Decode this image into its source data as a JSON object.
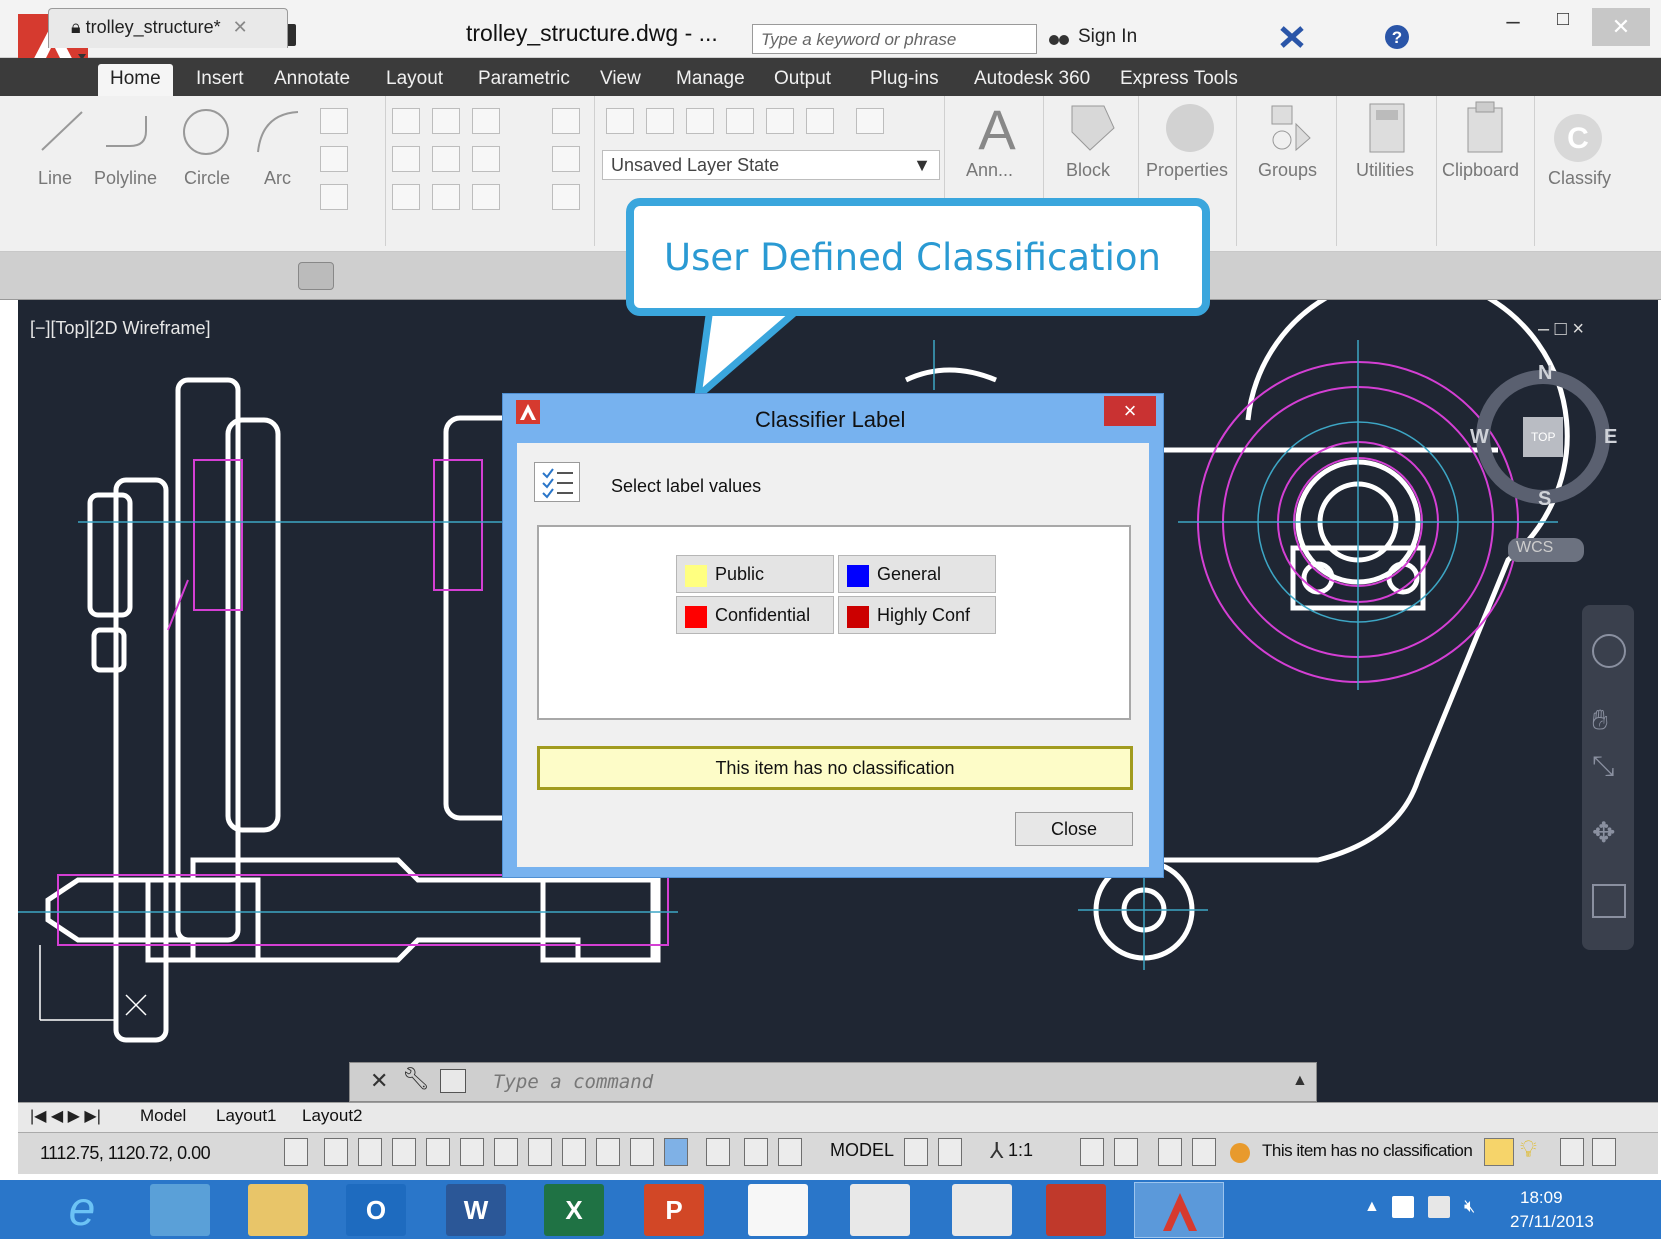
{
  "window": {
    "title": "trolley_structure.dwg - ...",
    "search_placeholder": "Type a keyword or phrase",
    "sign_in": "Sign In"
  },
  "ribbon_tabs": [
    "Home",
    "Insert",
    "Annotate",
    "Layout",
    "Parametric",
    "View",
    "Manage",
    "Output",
    "Plug-ins",
    "Autodesk 360",
    "Express Tools"
  ],
  "ribbon": {
    "draw_tools": [
      "Line",
      "Polyline",
      "Circle",
      "Arc"
    ],
    "layer_state": "Unsaved Layer State",
    "panels": [
      "Ann...",
      "Block",
      "Properties",
      "Groups",
      "Utilities",
      "Clipboard",
      "Classify"
    ]
  },
  "doc_tab": "trolley_structure*",
  "viewport_label": "[−][Top][2D Wireframe]",
  "viewport_controls": "– □ ×",
  "viewcube": {
    "n": "N",
    "s": "S",
    "e": "E",
    "w": "W",
    "top": "TOP",
    "wcs": "WCS"
  },
  "callout": {
    "text": "User Defined Classification"
  },
  "dialog": {
    "title": "Classifier Label",
    "close_x": "×",
    "instruction": "Select label values",
    "labels": [
      {
        "text": "Public",
        "color": "#ffff80"
      },
      {
        "text": "General",
        "color": "#0000ff"
      },
      {
        "text": "Confidential",
        "color": "#ff0000"
      },
      {
        "text": "Highly Conf",
        "color": "#cc0000"
      }
    ],
    "status": "This item has no classification",
    "close_label": "Close"
  },
  "command_line": {
    "placeholder": "Type a command"
  },
  "layout_tabs": [
    "Model",
    "Layout1",
    "Layout2"
  ],
  "status_bar": {
    "coords": "1112.75, 1120.72, 0.00",
    "model": "MODEL",
    "scale": "1:1",
    "classification": "This item has no classification"
  },
  "taskbar": {
    "time": "18:09",
    "date": "27/11/2013"
  }
}
